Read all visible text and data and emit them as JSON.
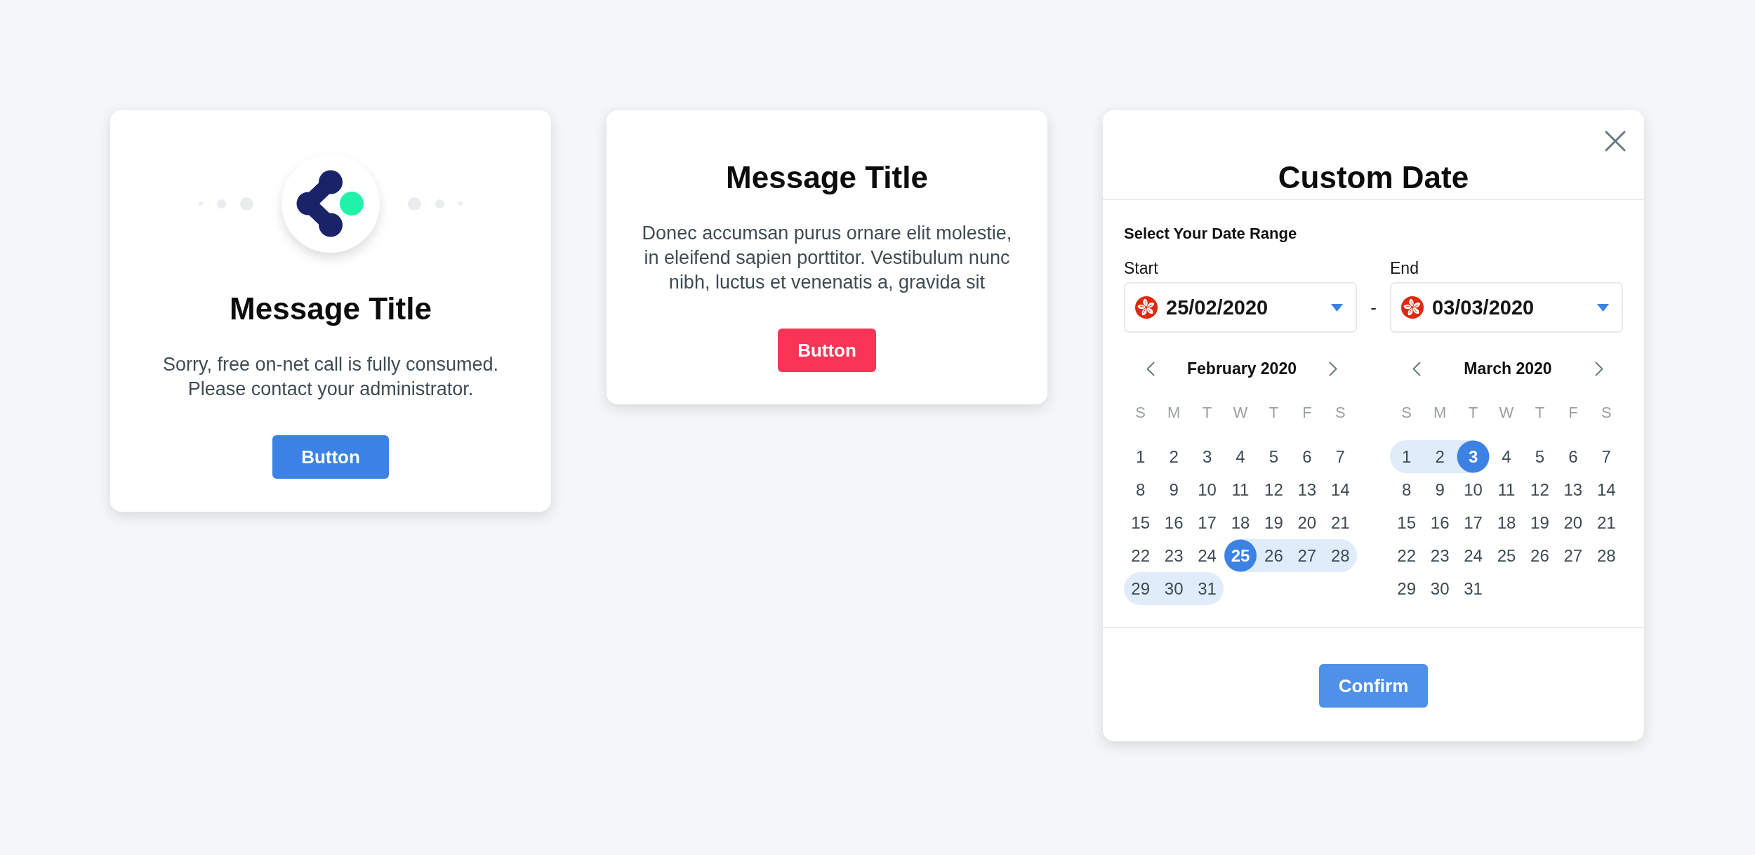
{
  "message_dialogs": [
    {
      "kind": "with_logo",
      "title": "Message Title",
      "message": "Sorry, free on-net call is fully consumed. Please contact your administrator.",
      "button": {
        "label": "Button",
        "kind": "primary"
      }
    },
    {
      "kind": "plain",
      "title": "Message Title",
      "message": "Donec accumsan purus ornare elit molestie, in eleifend sapien porttitor. Vestibulum nunc nibh, luctus et venenatis a, gravida sit",
      "button": {
        "label": "Button",
        "kind": "danger"
      }
    }
  ],
  "date_dialog": {
    "title": "Custom Date",
    "section_label": "Select Your Date Range",
    "start": {
      "label": "Start",
      "value": "25/02/2020"
    },
    "separator": "-",
    "end": {
      "label": "End",
      "value": "03/03/2020"
    },
    "calendars": [
      {
        "month": "February 2020",
        "weekdays": [
          "S",
          "M",
          "T",
          "W",
          "T",
          "F",
          "S"
        ],
        "days": [
          {
            "day": "1",
            "selected": false,
            "in_range": false
          },
          {
            "day": "2",
            "selected": false,
            "in_range": false
          },
          {
            "day": "3",
            "selected": false,
            "in_range": false
          },
          {
            "day": "4",
            "selected": false,
            "in_range": false
          },
          {
            "day": "5",
            "selected": false,
            "in_range": false
          },
          {
            "day": "6",
            "selected": false,
            "in_range": false
          },
          {
            "day": "7",
            "selected": false,
            "in_range": false
          },
          {
            "day": "8",
            "selected": false,
            "in_range": false
          },
          {
            "day": "9",
            "selected": false,
            "in_range": false
          },
          {
            "day": "10",
            "selected": false,
            "in_range": false
          },
          {
            "day": "11",
            "selected": false,
            "in_range": false
          },
          {
            "day": "12",
            "selected": false,
            "in_range": false
          },
          {
            "day": "13",
            "selected": false,
            "in_range": false
          },
          {
            "day": "14",
            "selected": false,
            "in_range": false
          },
          {
            "day": "15",
            "selected": false,
            "in_range": false
          },
          {
            "day": "16",
            "selected": false,
            "in_range": false
          },
          {
            "day": "17",
            "selected": false,
            "in_range": false
          },
          {
            "day": "18",
            "selected": false,
            "in_range": false
          },
          {
            "day": "19",
            "selected": false,
            "in_range": false
          },
          {
            "day": "20",
            "selected": false,
            "in_range": false
          },
          {
            "day": "21",
            "selected": false,
            "in_range": false
          },
          {
            "day": "22",
            "selected": false,
            "in_range": false
          },
          {
            "day": "23",
            "selected": false,
            "in_range": false
          },
          {
            "day": "24",
            "selected": false,
            "in_range": false
          },
          {
            "day": "25",
            "selected": true,
            "in_range": true
          },
          {
            "day": "26",
            "selected": false,
            "in_range": true
          },
          {
            "day": "27",
            "selected": false,
            "in_range": true
          },
          {
            "day": "28",
            "selected": false,
            "in_range": true
          },
          {
            "day": "29",
            "selected": false,
            "in_range": true
          },
          {
            "day": "30",
            "selected": false,
            "in_range": true
          },
          {
            "day": "31",
            "selected": false,
            "in_range": true
          }
        ]
      },
      {
        "month": "March 2020",
        "weekdays": [
          "S",
          "M",
          "T",
          "W",
          "T",
          "F",
          "S"
        ],
        "days": [
          {
            "day": "1",
            "selected": false,
            "in_range": true
          },
          {
            "day": "2",
            "selected": false,
            "in_range": true
          },
          {
            "day": "3",
            "selected": true,
            "in_range": true
          },
          {
            "day": "4",
            "selected": false,
            "in_range": false
          },
          {
            "day": "5",
            "selected": false,
            "in_range": false
          },
          {
            "day": "6",
            "selected": false,
            "in_range": false
          },
          {
            "day": "7",
            "selected": false,
            "in_range": false
          },
          {
            "day": "8",
            "selected": false,
            "in_range": false
          },
          {
            "day": "9",
            "selected": false,
            "in_range": false
          },
          {
            "day": "10",
            "selected": false,
            "in_range": false
          },
          {
            "day": "11",
            "selected": false,
            "in_range": false
          },
          {
            "day": "12",
            "selected": false,
            "in_range": false
          },
          {
            "day": "13",
            "selected": false,
            "in_range": false
          },
          {
            "day": "14",
            "selected": false,
            "in_range": false
          },
          {
            "day": "15",
            "selected": false,
            "in_range": false
          },
          {
            "day": "16",
            "selected": false,
            "in_range": false
          },
          {
            "day": "17",
            "selected": false,
            "in_range": false
          },
          {
            "day": "18",
            "selected": false,
            "in_range": false
          },
          {
            "day": "19",
            "selected": false,
            "in_range": false
          },
          {
            "day": "20",
            "selected": false,
            "in_range": false
          },
          {
            "day": "21",
            "selected": false,
            "in_range": false
          },
          {
            "day": "22",
            "selected": false,
            "in_range": false
          },
          {
            "day": "23",
            "selected": false,
            "in_range": false
          },
          {
            "day": "24",
            "selected": false,
            "in_range": false
          },
          {
            "day": "25",
            "selected": false,
            "in_range": false
          },
          {
            "day": "26",
            "selected": false,
            "in_range": false
          },
          {
            "day": "27",
            "selected": false,
            "in_range": false
          },
          {
            "day": "28",
            "selected": false,
            "in_range": false
          },
          {
            "day": "29",
            "selected": false,
            "in_range": false
          },
          {
            "day": "30",
            "selected": false,
            "in_range": false
          },
          {
            "day": "31",
            "selected": false,
            "in_range": false
          }
        ]
      }
    ],
    "confirm_button": {
      "label": "Confirm"
    }
  }
}
